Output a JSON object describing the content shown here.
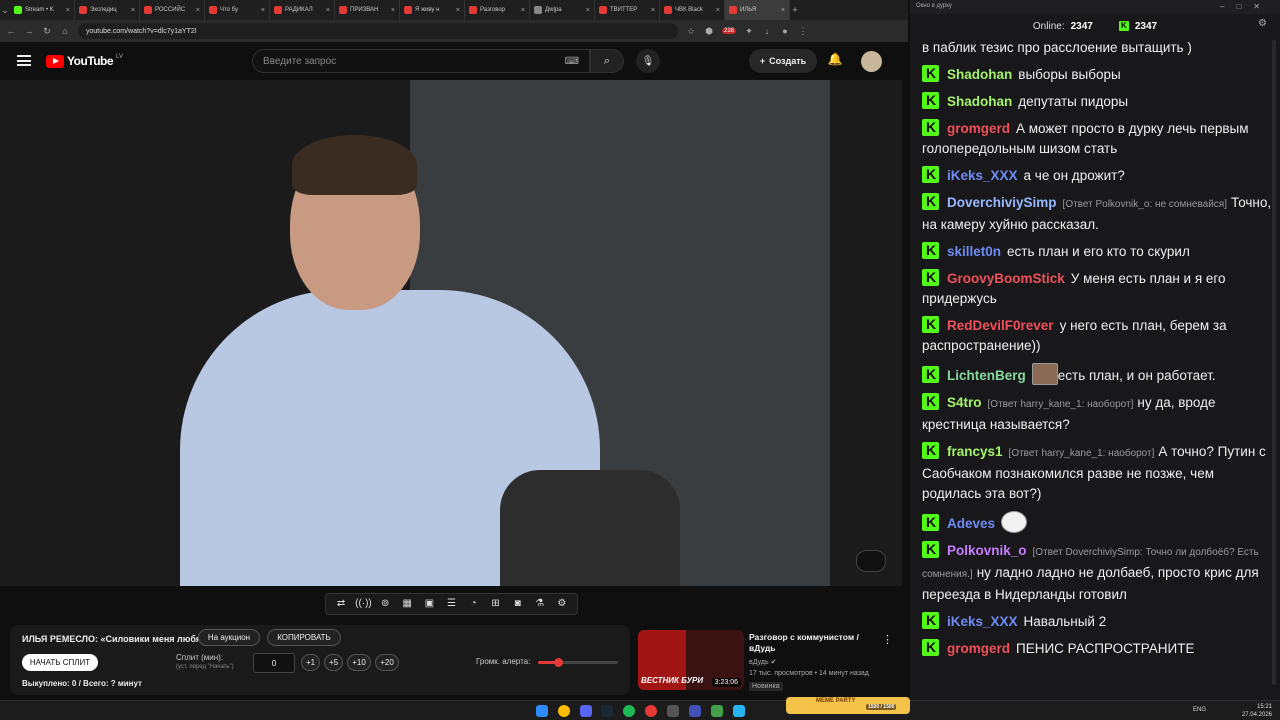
{
  "browser": {
    "tabs": [
      {
        "label": "Stream • K",
        "fav": "green"
      },
      {
        "label": "Экспедиц",
        "fav": "red"
      },
      {
        "label": "РОССИЙС",
        "fav": "red"
      },
      {
        "label": "Что бу",
        "fav": "red"
      },
      {
        "label": "РАДИКАЛ",
        "fav": "red"
      },
      {
        "label": "ПРИЗВАН",
        "fav": "red"
      },
      {
        "label": "Я живу н",
        "fav": "red"
      },
      {
        "label": "Разговор",
        "fav": "red"
      },
      {
        "label": "Дw|ра",
        "fav": "gray"
      },
      {
        "label": "ТВИТТЕР",
        "fav": "red"
      },
      {
        "label": "ЧВК Black",
        "fav": "red"
      },
      {
        "label": "ИЛЬЯ",
        "fav": "red"
      }
    ],
    "url": "youtube.com/watch?v=dlc7y1aYT2I",
    "ext_badge": "238"
  },
  "youtube": {
    "logo_text": "YouTube",
    "region": "LV",
    "search_placeholder": "Введите запрос",
    "create_label": "Создать"
  },
  "under": {
    "title": "ИЛЬЯ РЕМЕСЛО: «Силовики меня любят»",
    "auction_label": "На аукцион",
    "copy_label": "КОПИРОВАТЬ",
    "start_split_label": "НАЧАТЬ СПЛИТ",
    "split_label": "Сплит (мин):",
    "split_sub": "(уст. перед \"Начать\")",
    "split_value": "0",
    "steps": [
      "+1",
      "+5",
      "+10",
      "+20"
    ],
    "volume_label": "Громк. алерта:",
    "volume_level": 0.25,
    "bought_text": "Выкуплено: 0 / Всего: ? минут"
  },
  "recommendation": {
    "title": "Разговор с коммунистом / вДудь",
    "channel": "вДудь",
    "meta": "17 тыс. просмотров • 14 минут назад",
    "badge": "Новинка",
    "duration": "3:23:06",
    "thumb_label": "ВЕСТНИК БУРИ"
  },
  "chat": {
    "window_title": "Окно в дурку",
    "online_label": "Online:",
    "online_count": "2347",
    "kick_count": "2347",
    "messages": [
      {
        "user": "",
        "color": "#efeff1",
        "reply": "",
        "text": "в паблик тезис про расслоение вытащить )",
        "badge": false
      },
      {
        "user": "Shadohan",
        "color": "#a6f36a",
        "reply": "",
        "text": "выборы выборы",
        "badge": true
      },
      {
        "user": "Shadohan",
        "color": "#a6f36a",
        "reply": "",
        "text": "депутаты пидоры",
        "badge": true
      },
      {
        "user": "gromgerd",
        "color": "#f0505a",
        "reply": "",
        "text": "А может просто в дурку лечь первым голопередольным шизом стать",
        "badge": true
      },
      {
        "user": "iKeks_XXX",
        "color": "#6f8cf5",
        "reply": "",
        "text": "а че он дрожит?",
        "badge": true
      },
      {
        "user": "DoverchiviySimp",
        "color": "#9ab8ff",
        "reply": "[Ответ Polkovnik_o: не сомневайся]",
        "text": "Точно, на камеру хуйню рассказал.",
        "badge": true
      },
      {
        "user": "skillet0n",
        "color": "#6f8cf5",
        "reply": "",
        "text": "есть план и его кто то скурил",
        "badge": true
      },
      {
        "user": "GroovyBoomStick",
        "color": "#f0505a",
        "reply": "",
        "text": "У меня есть план и я его придержусь",
        "badge": true
      },
      {
        "user": "RedDevilF0rever",
        "color": "#f0505a",
        "reply": "",
        "text": "у него есть план, берем за распространение))",
        "badge": true
      },
      {
        "user": "LichtenBerg",
        "color": "#87d7a0",
        "reply": "",
        "text": "есть план, и он работает.",
        "badge": true
      },
      {
        "user": "S4tro",
        "color": "#a6f36a",
        "reply": "[Ответ harry_kane_1: наоборот]",
        "text": "ну да, вроде крестница называется?",
        "badge": true
      },
      {
        "user": "francys1",
        "color": "#a6f36a",
        "reply": "[Ответ harry_kane_1: наоборот]",
        "text": "А точно? Путин с Саобчаком познакомился разве не позже, чем родилась эта вот?)",
        "badge": true
      },
      {
        "user": "Adeves",
        "color": "#6f8cf5",
        "reply": "",
        "text": "",
        "badge": true
      },
      {
        "user": "Polkovnik_o",
        "color": "#c77dff",
        "reply": "[Ответ DoverchiviySimp: Точно ли долбоёб? Есть сомнения.]",
        "text": "ну ладно ладно не долбаеб, просто крис для переезда в Нидерланды готовил",
        "badge": true
      },
      {
        "user": "iKeks_XXX",
        "color": "#6f8cf5",
        "reply": "",
        "text": "Навальный 2",
        "badge": true
      },
      {
        "user": "gromgerd",
        "color": "#f0505a",
        "reply": "",
        "text": "ПЕНИС РАСПРОСТРАНИТЕ",
        "badge": true
      }
    ]
  },
  "taskbar": {
    "lang": "ENG",
    "time": "15:21",
    "date": "27.04.2026",
    "meme_label": "MEME PARTY",
    "meme_progress": "1500 / 1500"
  }
}
